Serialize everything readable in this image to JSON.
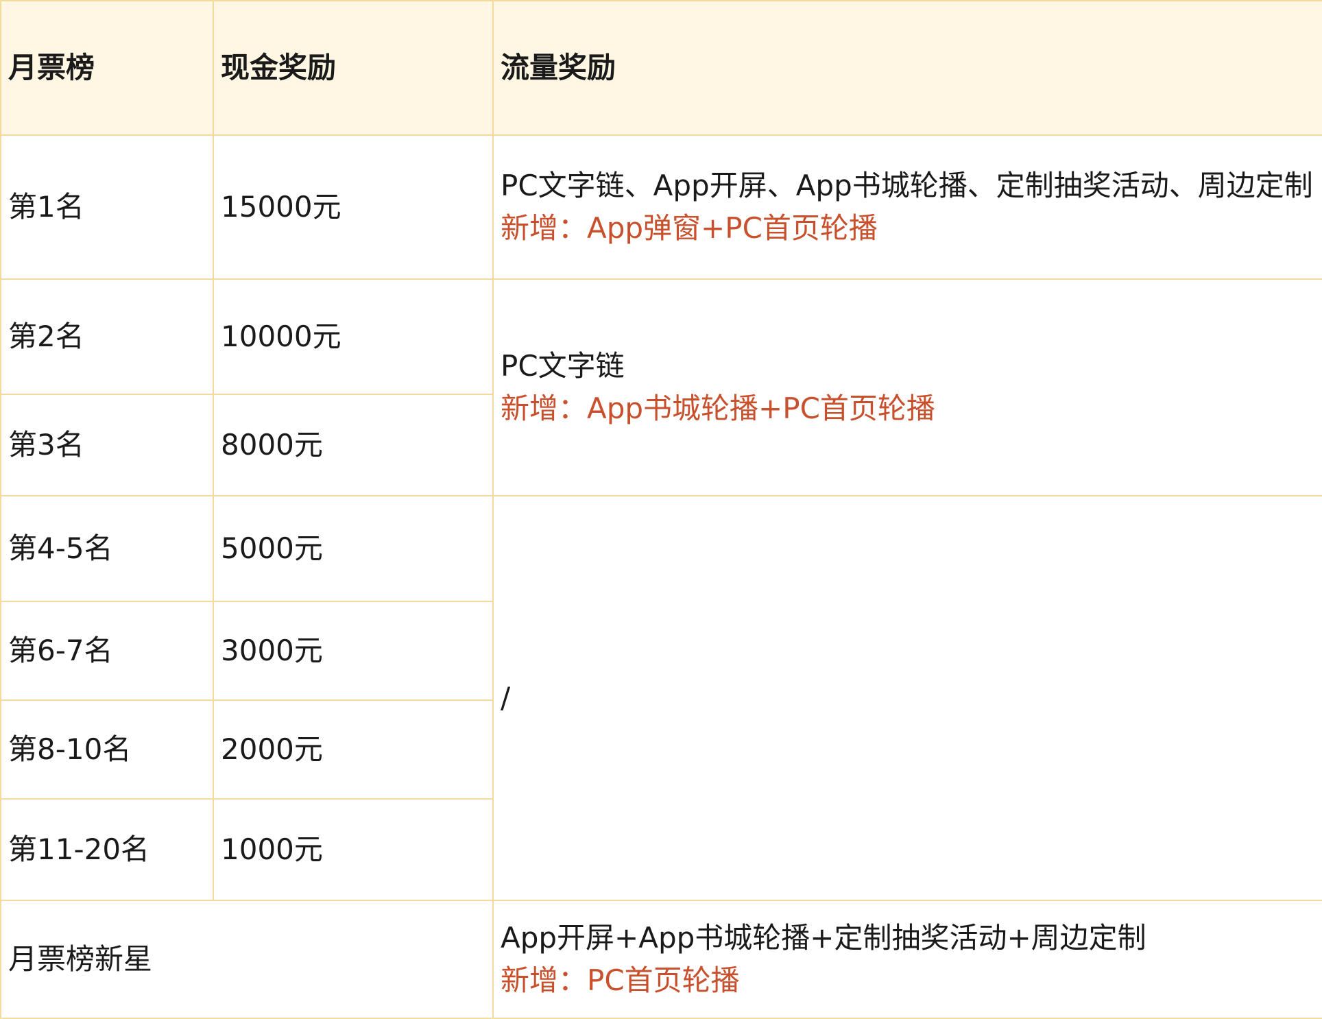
{
  "header": {
    "col_rank": "月票榜",
    "col_cash": "现金奖励",
    "col_traffic": "流量奖励"
  },
  "rows": [
    {
      "rank": "第1名",
      "cash": "15000元"
    },
    {
      "rank": "第2名",
      "cash": "10000元"
    },
    {
      "rank": "第3名",
      "cash": "8000元"
    },
    {
      "rank": "第4-5名",
      "cash": "5000元"
    },
    {
      "rank": "第6-7名",
      "cash": "3000元"
    },
    {
      "rank": "第8-10名",
      "cash": "2000元"
    },
    {
      "rank": "第11-20名",
      "cash": "1000元"
    }
  ],
  "traffic": {
    "group1": {
      "base": "PC文字链、App开屏、App书城轮播、定制抽奖活动、周边定制",
      "new": "新增：App弹窗+PC首页轮播"
    },
    "group2": {
      "base": "PC文字链",
      "new": "新增：App书城轮播+PC首页轮播"
    },
    "group3": {
      "base": "/"
    }
  },
  "newstar": {
    "label": "月票榜新星",
    "base": "App开屏+App书城轮播+定制抽奖活动+周边定制",
    "new": "新增：PC首页轮播"
  }
}
